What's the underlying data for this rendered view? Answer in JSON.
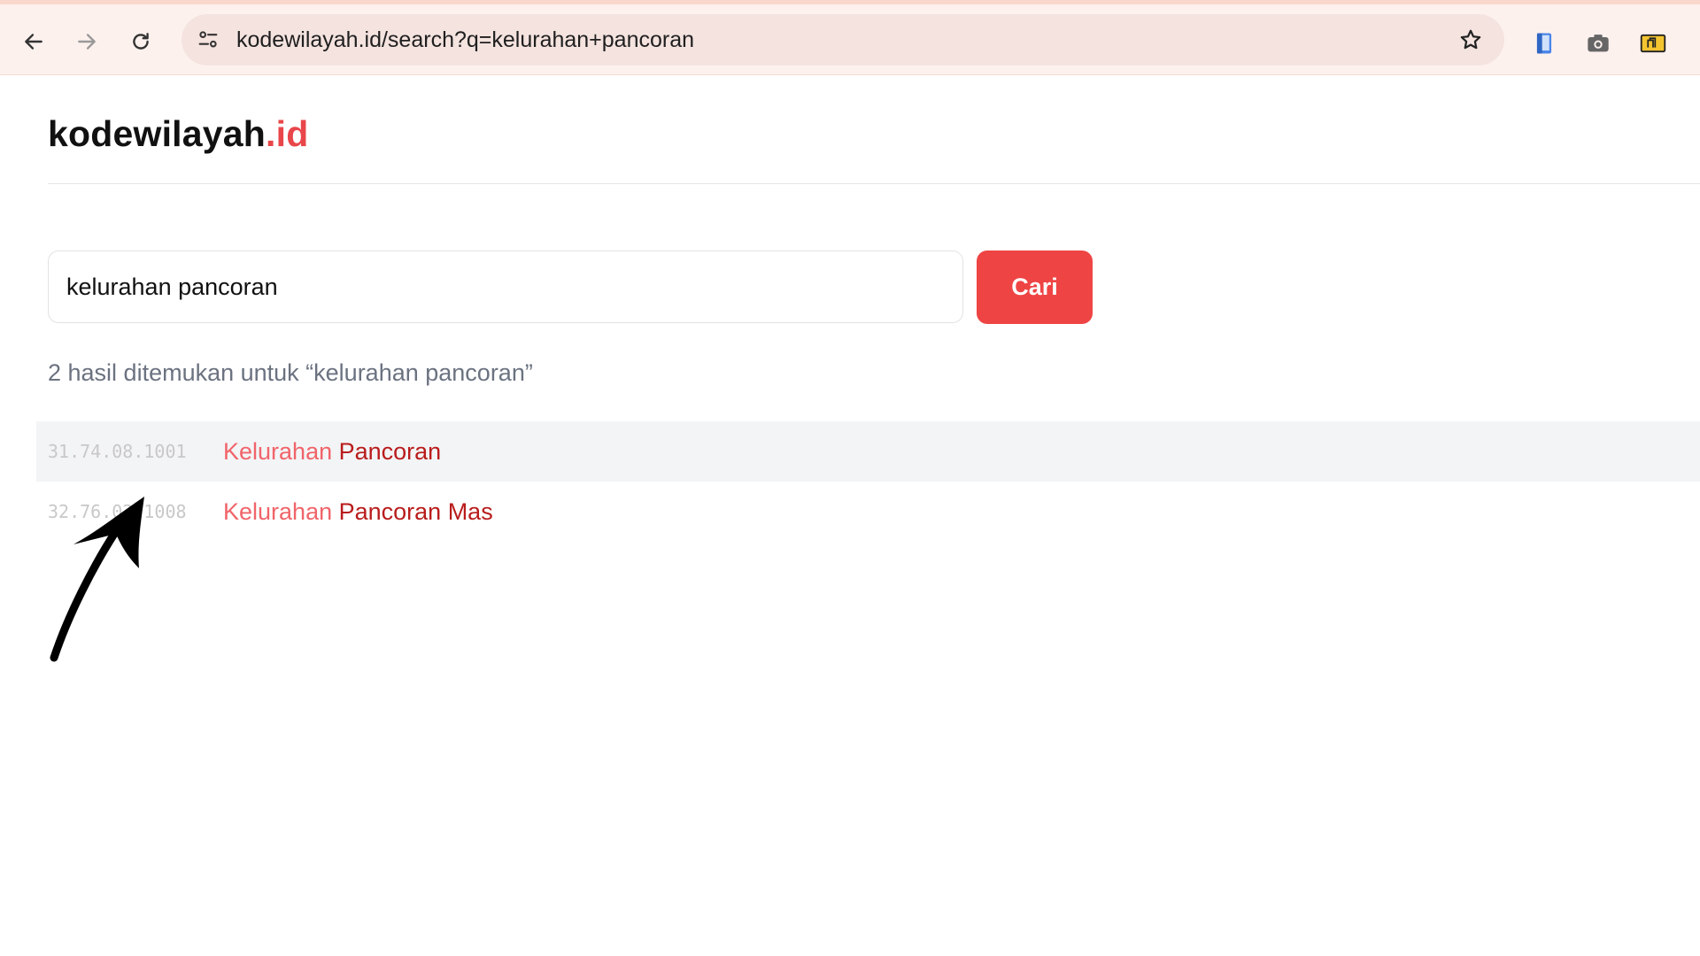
{
  "browser": {
    "url": "kodewilayah.id/search?q=kelurahan+pancoran",
    "icons": [
      "back-icon",
      "forward-icon",
      "reload-icon",
      "site-info-icon",
      "bookmark-star-icon",
      "extension-phone-icon",
      "camera-icon",
      "extension-folder-icon"
    ]
  },
  "site": {
    "logo_name": "kodewilayah",
    "logo_tld": ".id"
  },
  "search": {
    "query": "kelurahan pancoran",
    "button_label": "Cari"
  },
  "results": {
    "summary": "2 hasil ditemukan untuk “kelurahan pancoran”",
    "items": [
      {
        "code": "31.74.08.1001",
        "name_match": "Kelurahan",
        "name_rest": " Pancoran"
      },
      {
        "code": "32.76.02.1008",
        "name_match": "Kelurahan",
        "name_rest": " Pancoran Mas"
      }
    ]
  },
  "colors": {
    "accent": "#ef4444",
    "logo_tld": "#e8464a",
    "link_highlight": "#f0646a",
    "link": "#b91c1c",
    "browser_bg": "#fdf1ee"
  }
}
